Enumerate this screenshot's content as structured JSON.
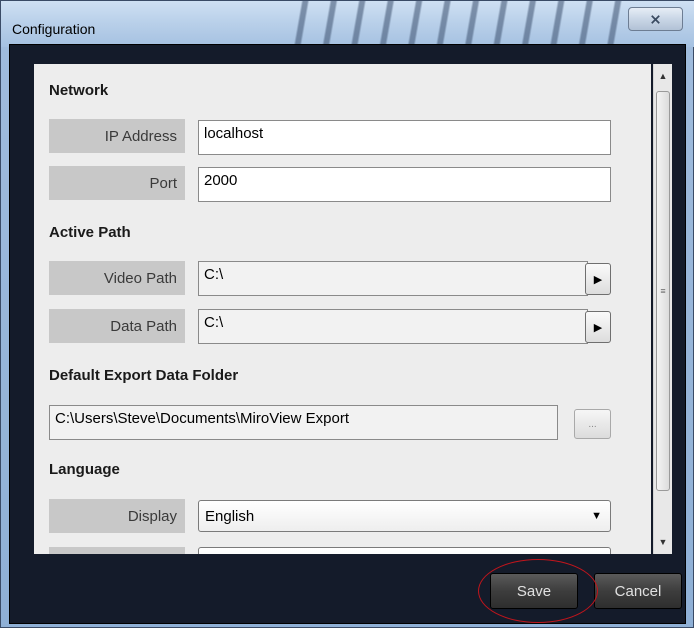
{
  "window": {
    "title": "Configuration",
    "close_icon": "close-icon",
    "close_glyph": "⨯"
  },
  "network": {
    "heading": "Network",
    "ip_label": "IP Address",
    "ip_value": "localhost",
    "port_label": "Port",
    "port_value": "2000"
  },
  "active_path": {
    "heading": "Active Path",
    "video_label": "Video Path",
    "video_value": "C:\\",
    "data_label": "Data Path",
    "data_value": "C:\\",
    "arrow_icon": "play-arrow-icon",
    "arrow_glyph": "▶"
  },
  "export": {
    "heading": "Default Export Data Folder",
    "folder_value": "C:\\Users\\Steve\\Documents\\MiroView Export",
    "browse_label": "..."
  },
  "language": {
    "heading": "Language",
    "display_label": "Display",
    "display_value": "English",
    "caret_glyph": "▼"
  },
  "scrollbar": {
    "up_glyph": "▲",
    "down_glyph": "▼",
    "grip_glyph": "≡"
  },
  "footer": {
    "save_label": "Save",
    "cancel_label": "Cancel"
  },
  "colors": {
    "highlight": "#c0151c",
    "panel_bg": "#ededed",
    "frame": "#1c2a44"
  }
}
